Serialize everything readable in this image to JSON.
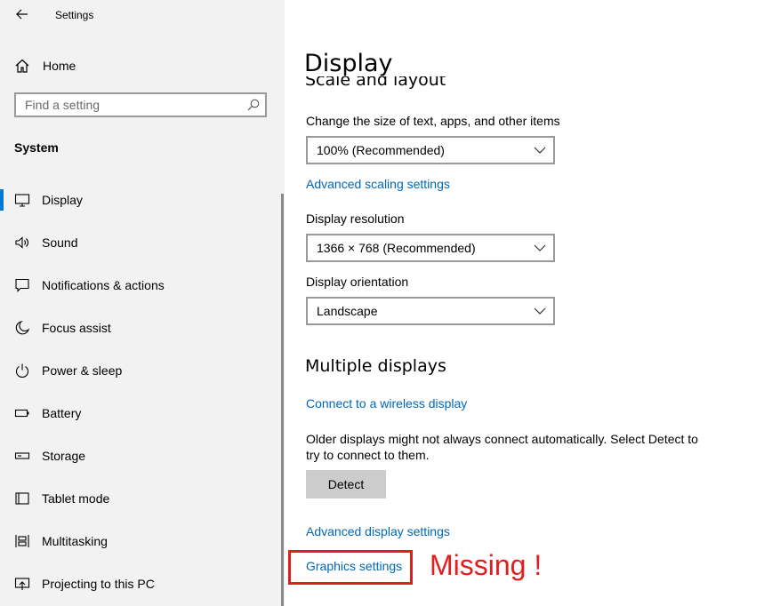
{
  "window": {
    "title": "Settings"
  },
  "sidebar": {
    "home_label": "Home",
    "search_placeholder": "Find a setting",
    "section_title": "System",
    "items": [
      {
        "label": "Display",
        "icon": "monitor-icon",
        "selected": true
      },
      {
        "label": "Sound",
        "icon": "speaker-icon"
      },
      {
        "label": "Notifications & actions",
        "icon": "notification-icon"
      },
      {
        "label": "Focus assist",
        "icon": "moon-icon"
      },
      {
        "label": "Power & sleep",
        "icon": "power-icon"
      },
      {
        "label": "Battery",
        "icon": "battery-icon"
      },
      {
        "label": "Storage",
        "icon": "storage-icon"
      },
      {
        "label": "Tablet mode",
        "icon": "tablet-icon"
      },
      {
        "label": "Multitasking",
        "icon": "multitasking-icon"
      },
      {
        "label": "Projecting to this PC",
        "icon": "projector-icon"
      }
    ]
  },
  "main": {
    "page_title": "Display",
    "scale_heading": "Scale and layout",
    "scale_label": "Change the size of text, apps, and other items",
    "scale_value": "100% (Recommended)",
    "advanced_scaling_link": "Advanced scaling settings",
    "resolution_label": "Display resolution",
    "resolution_value": "1366 × 768 (Recommended)",
    "orientation_label": "Display orientation",
    "orientation_value": "Landscape",
    "multiple_displays_heading": "Multiple displays",
    "wireless_link": "Connect to a wireless display",
    "detect_text": "Older displays might not always connect automatically. Select Detect to try to connect to them.",
    "detect_button": "Detect",
    "advanced_display_link": "Advanced display settings",
    "graphics_link": "Graphics settings"
  },
  "annotation": {
    "text": "Missing !",
    "color": "#e11d1d"
  },
  "colors": {
    "accent": "#0078d7",
    "link": "#0067b8",
    "sidebar_bg": "#f2f2f2"
  }
}
